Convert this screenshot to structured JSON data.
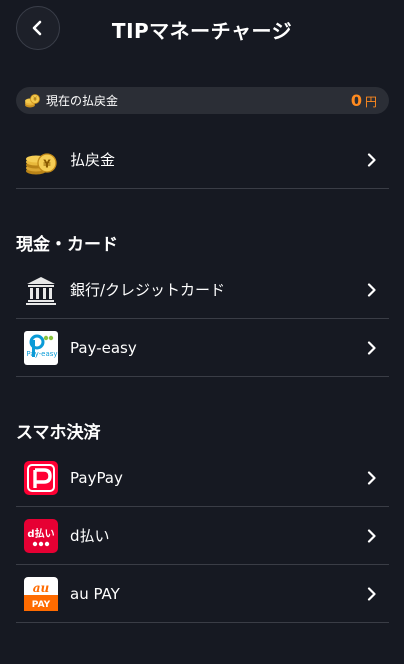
{
  "header": {
    "title": "TIPマネーチャージ"
  },
  "balance": {
    "label": "現在の払戻金",
    "amount": "0",
    "unit": "円"
  },
  "refund": {
    "label": "払戻金"
  },
  "cash_section": {
    "title": "現金・カード",
    "items": [
      {
        "label": "銀行/クレジットカード",
        "icon": "bank-icon"
      },
      {
        "label": "Pay-easy",
        "icon": "payeasy-logo-icon"
      }
    ]
  },
  "smartphone_section": {
    "title": "スマホ決済",
    "items": [
      {
        "label": "PayPay",
        "icon": "paypay-logo-icon"
      },
      {
        "label": "d払い",
        "icon": "d-barai-logo-icon"
      },
      {
        "label": "au PAY",
        "icon": "au-pay-logo-icon"
      }
    ]
  },
  "logos": {
    "payeasy_text": "Pay-easy",
    "d_text": "d払い",
    "au_text": "au",
    "au_pay_text": "PAY"
  },
  "colors": {
    "accent": "#ff8a1f",
    "background": "#161922",
    "paypay": "#ff0033",
    "dbarai": "#e60033",
    "aupay": "#ff6b00"
  }
}
